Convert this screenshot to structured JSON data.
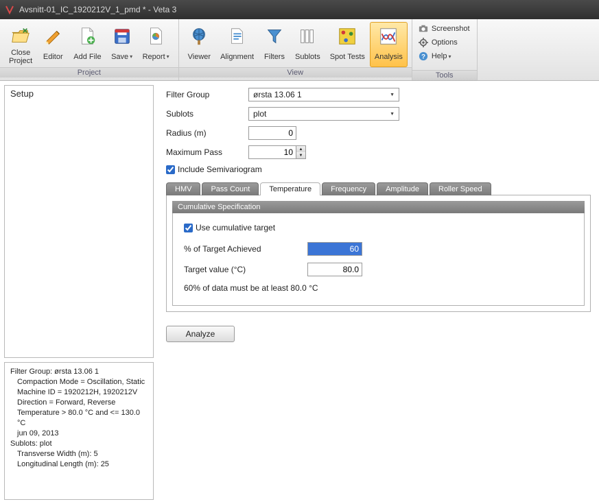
{
  "window": {
    "title": "Avsnitt-01_IC_1920212V_1_pmd * - Veta 3"
  },
  "ribbon": {
    "groups": {
      "project": {
        "label": "Project",
        "close": "Close Project",
        "editor": "Editor",
        "addfile": "Add File",
        "save": "Save",
        "report": "Report"
      },
      "view": {
        "label": "View",
        "viewer": "Viewer",
        "alignment": "Alignment",
        "filters": "Filters",
        "sublots": "Sublots",
        "spottests": "Spot Tests",
        "analysis": "Analysis"
      },
      "tools": {
        "label": "Tools",
        "screenshot": "Screenshot",
        "options": "Options",
        "help": "Help"
      }
    }
  },
  "sidebar": {
    "setup": "Setup"
  },
  "form": {
    "filter_group_label": "Filter Group",
    "filter_group_value": "ørsta 13.06 1",
    "sublots_label": "Sublots",
    "sublots_value": "plot",
    "radius_label": "Radius (m)",
    "radius_value": "0",
    "maxpass_label": "Maximum Pass",
    "maxpass_value": "10",
    "include_semi": "Include Semivariogram"
  },
  "tabs": {
    "hmv": "HMV",
    "passcount": "Pass Count",
    "temperature": "Temperature",
    "frequency": "Frequency",
    "amplitude": "Amplitude",
    "rollerspeed": "Roller Speed"
  },
  "spec": {
    "header": "Cumulative Specification",
    "use_cumulative": "Use cumulative target",
    "pct_label": "% of Target Achieved",
    "pct_value": "60",
    "target_label": "Target value (°C)",
    "target_value": "80.0",
    "hint": "60% of data must be at least 80.0 °C"
  },
  "analyze": "Analyze",
  "info": {
    "l1": "Filter Group: ørsta 13.06 1",
    "l2": "Compaction Mode = Oscillation, Static",
    "l3": "Machine ID = 1920212H, 1920212V",
    "l4": "Direction = Forward, Reverse",
    "l5": "Temperature > 80.0 °C and <= 130.0 °C",
    "l6": "jun 09, 2013",
    "l7": "Sublots: plot",
    "l8": "Transverse Width (m): 5",
    "l9": "Longitudinal Length (m): 25"
  }
}
